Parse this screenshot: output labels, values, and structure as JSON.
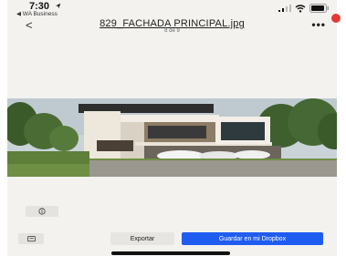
{
  "status_bar": {
    "time": "7:30",
    "back_app": "◀ WA Business"
  },
  "header": {
    "back_symbol": "<",
    "file_name": "829_FACHADA PRINCIPAL.jpg",
    "page_counter": "8 de 9",
    "more_symbol": "•••"
  },
  "actions": {
    "export_label": "Exportar",
    "save_label": "Guardar en mi Dropbox"
  },
  "colors": {
    "accent": "#1f5cf0",
    "background": "#f3f2ef"
  }
}
